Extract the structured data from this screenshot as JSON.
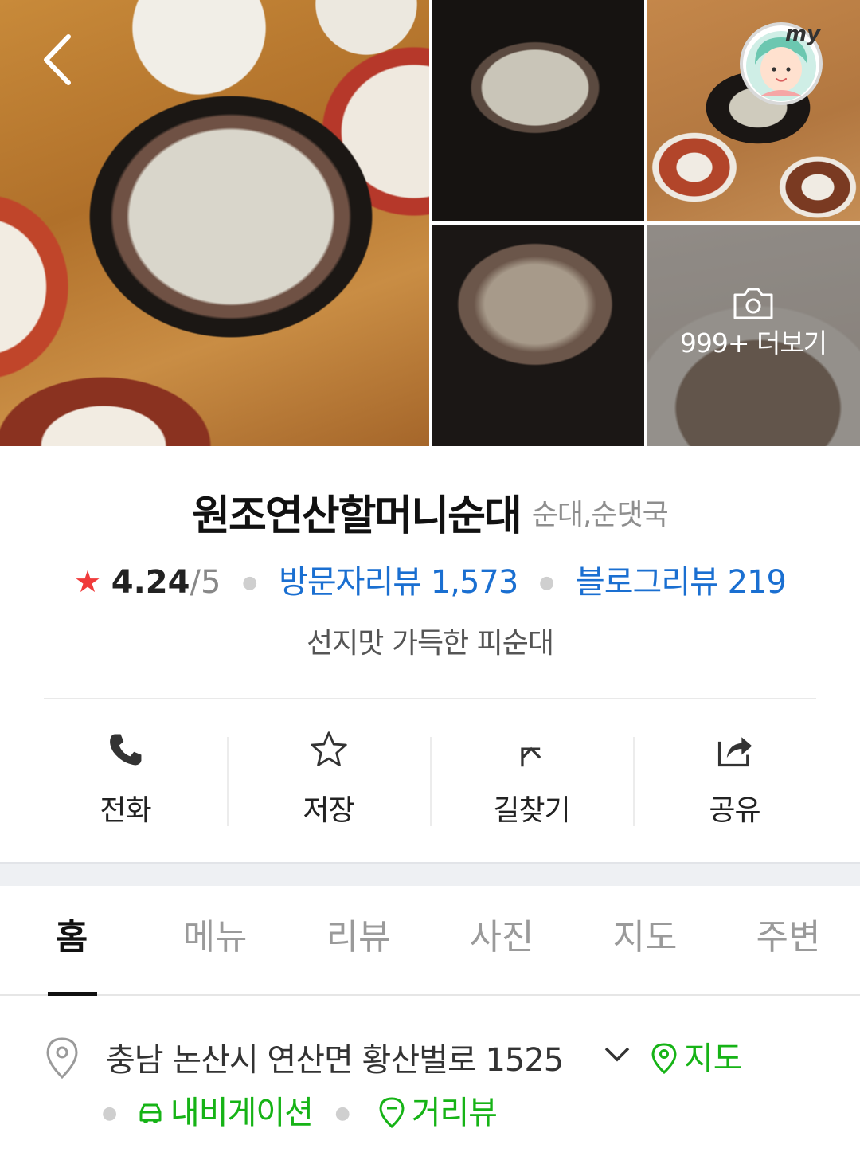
{
  "gallery": {
    "more_label": "999+ 더보기"
  },
  "place": {
    "name": "원조연산할머니순대",
    "category": "순대,순댓국",
    "rating": "4.24",
    "rating_max": "/5",
    "visitor_reviews_label": "방문자리뷰 1,573",
    "blog_reviews_label": "블로그리뷰 219",
    "description": "선지맛 가득한 피순대"
  },
  "actions": {
    "call": "전화",
    "save": "저장",
    "directions": "길찾기",
    "share": "공유"
  },
  "tabs": [
    "홈",
    "메뉴",
    "리뷰",
    "사진",
    "지도",
    "주변"
  ],
  "active_tab": "홈",
  "address": {
    "text": "충남 논산시 연산면 황산벌로 1525",
    "map_label": "지도",
    "navigation_label": "내비게이션",
    "street_view_label": "거리뷰"
  },
  "colors": {
    "accent_green": "#16b316",
    "link_blue": "#1a6fd1",
    "star_red": "#f03b3b"
  },
  "icons": {
    "back": "chevron-left-icon",
    "avatar": "my-avatar-icon",
    "camera": "camera-icon",
    "call": "phone-icon",
    "save": "star-outline-icon",
    "directions": "turn-arrow-icon",
    "share": "share-icon",
    "address": "location-pin-icon",
    "map": "location-pin-icon",
    "navigation": "car-icon",
    "street_view": "map-pin-icon"
  }
}
